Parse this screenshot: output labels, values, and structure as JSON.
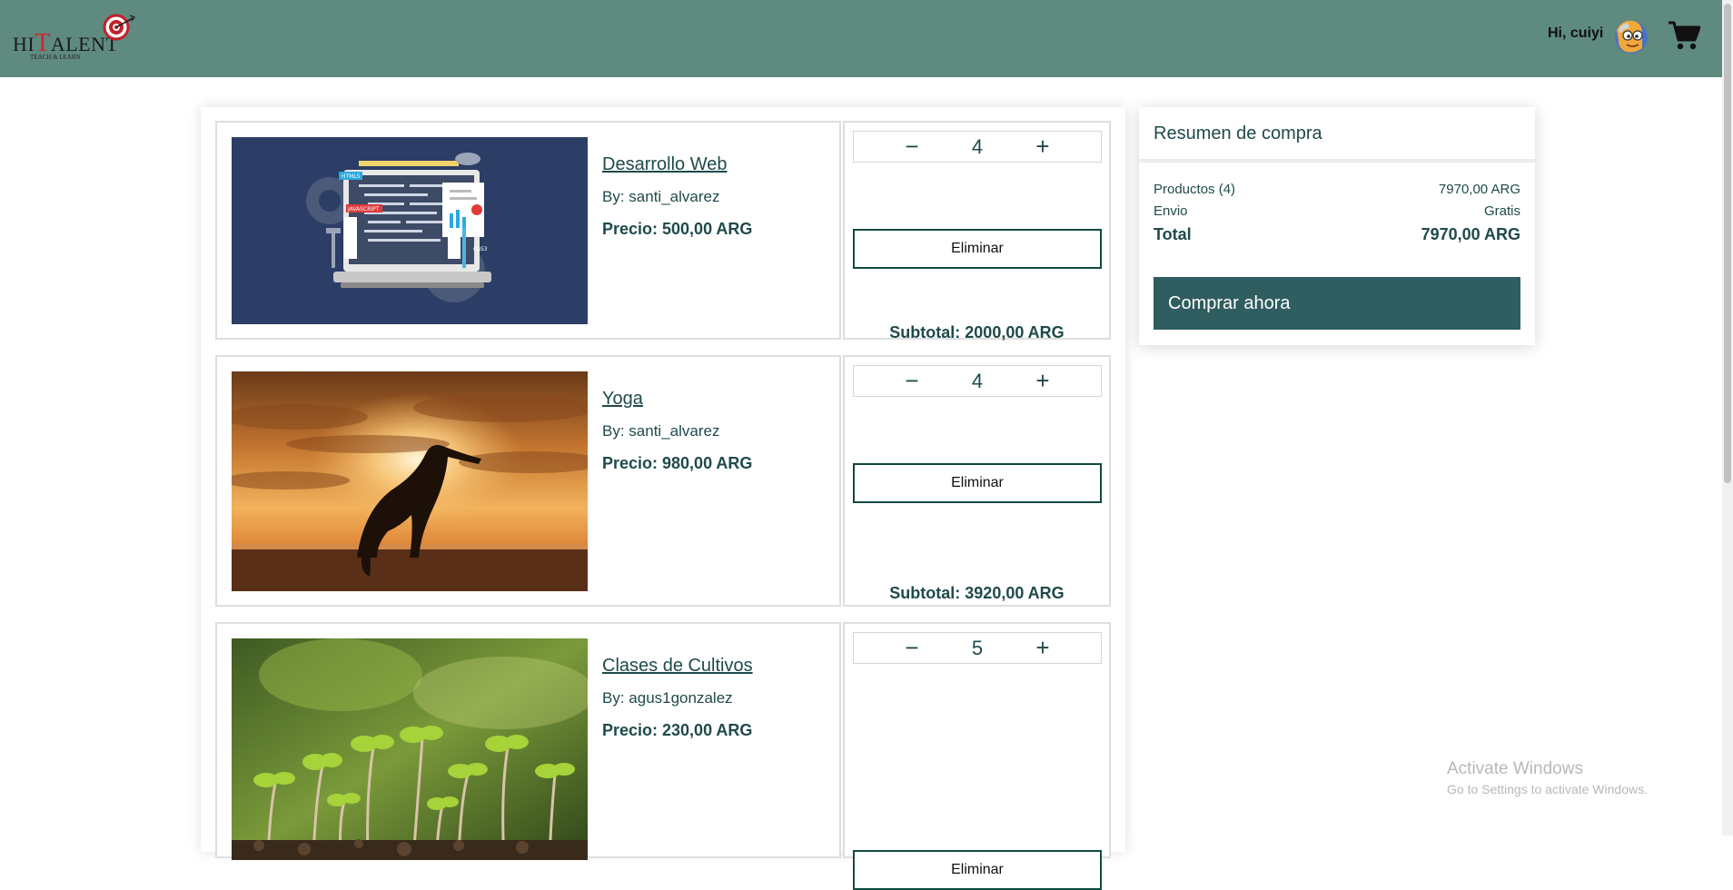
{
  "header": {
    "logo_text_pre": "HI",
    "logo_text_t": "T",
    "logo_text_post": "ALENT",
    "logo_tagline": "TEACH & LEARN",
    "greeting": "Hi, cuiyi",
    "background": "#5f8a7f"
  },
  "cart": {
    "items": [
      {
        "title": "Desarrollo Web",
        "author": "By: santi_alvarez",
        "price": "Precio: 500,00 ARG",
        "quantity": "4",
        "minus": "−",
        "plus": "+",
        "remove_label": "Eliminar",
        "subtotal": "Subtotal: 2000,00 ARG",
        "image": "web-development-illustration"
      },
      {
        "title": "Yoga",
        "author": "By: santi_alvarez",
        "price": "Precio: 980,00 ARG",
        "quantity": "4",
        "minus": "−",
        "plus": "+",
        "remove_label": "Eliminar",
        "subtotal": "Subtotal: 3920,00 ARG",
        "image": "yoga-sunset-photo"
      },
      {
        "title": "Clases de Cultivos",
        "author": "By: agus1gonzalez",
        "price": "Precio: 230,00 ARG",
        "quantity": "5",
        "minus": "−",
        "plus": "+",
        "remove_label": "Eliminar",
        "image": "seedlings-photo"
      }
    ],
    "web_image_labels": {
      "html5": "HTML5",
      "javascript": "JAVASCRIPT",
      "css3": "CSS3"
    }
  },
  "summary": {
    "title": "Resumen de compra",
    "products_label": "Productos (4)",
    "products_value": "7970,00 ARG",
    "shipping_label": "Envio",
    "shipping_value": "Gratis",
    "total_label": "Total",
    "total_value": "7970,00 ARG",
    "buy_label": "Comprar ahora",
    "button_color": "#2f5d60"
  },
  "watermark": {
    "line1": "Activate Windows",
    "line2": "Go to Settings to activate Windows."
  }
}
